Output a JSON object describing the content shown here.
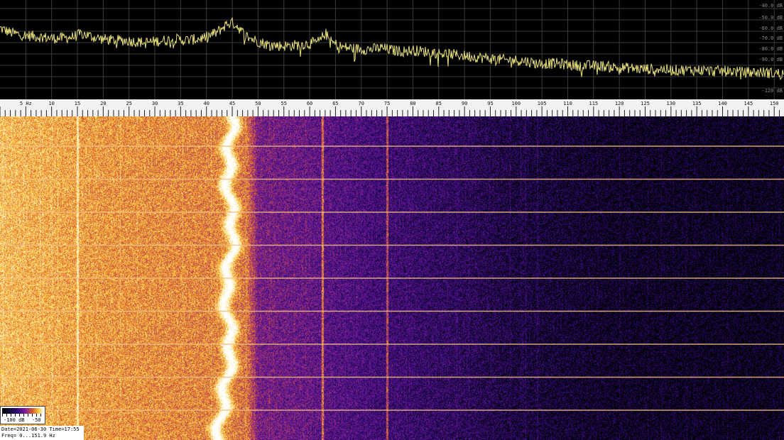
{
  "chart_data": [
    {
      "type": "line",
      "panel": "spectrum",
      "xlim": [
        0,
        151.9
      ],
      "ylim": [
        -120,
        -35
      ],
      "grid": true,
      "y_tick_labels": [
        "-40.0 dB",
        "-50.0 dB",
        "-60.0 dB",
        "-70.0 dB",
        "-80.0 dB",
        "-90.0 dB",
        "-120 dB"
      ],
      "x": [
        0,
        2,
        4,
        6,
        8,
        10,
        12,
        14,
        16,
        18,
        20,
        22,
        24,
        26,
        28,
        30,
        32,
        34,
        36,
        38,
        40,
        42,
        43,
        44,
        45,
        46,
        47,
        48,
        50,
        52,
        54,
        56,
        58,
        60,
        62,
        63,
        64,
        66,
        68,
        70,
        72,
        74,
        76,
        78,
        80,
        82,
        84,
        86,
        88,
        90,
        92,
        94,
        96,
        98,
        100,
        102,
        104,
        106,
        108,
        110,
        112,
        114,
        116,
        118,
        120,
        122,
        124,
        126,
        128,
        130,
        132,
        134,
        136,
        138,
        140,
        142,
        144,
        146,
        148,
        150,
        151.9
      ],
      "values": [
        -58,
        -62,
        -64,
        -65,
        -66,
        -67,
        -67,
        -66,
        -63,
        -66,
        -68,
        -69,
        -69,
        -70,
        -71,
        -70,
        -69,
        -68,
        -69,
        -68,
        -66,
        -62,
        -58,
        -54,
        -53,
        -56,
        -62,
        -66,
        -70,
        -73,
        -74,
        -74,
        -73,
        -72,
        -70,
        -62,
        -70,
        -75,
        -76,
        -77,
        -77,
        -76,
        -78,
        -79,
        -78,
        -79,
        -80,
        -81,
        -82,
        -83,
        -84,
        -85,
        -86,
        -87,
        -87,
        -88,
        -90,
        -90,
        -90,
        -91,
        -92,
        -92,
        -92,
        -93,
        -94,
        -94,
        -95,
        -95,
        -95,
        -96,
        -96,
        -96,
        -96,
        -97,
        -97,
        -97,
        -98,
        -98,
        -98,
        -99,
        -99
      ]
    },
    {
      "type": "heatmap",
      "panel": "waterfall",
      "xlim": [
        0,
        151.9
      ],
      "x_unit": "Hz",
      "x_tick_labels": [
        "5 Hz",
        "10",
        "15",
        "20",
        "25",
        "30",
        "35",
        "40",
        "45",
        "50",
        "55",
        "60",
        "65",
        "70",
        "75",
        "80",
        "85",
        "90",
        "95",
        "100",
        "105",
        "110",
        "115",
        "120",
        "125",
        "130",
        "135",
        "140",
        "145",
        "150"
      ],
      "x_tick_values": [
        5,
        10,
        15,
        20,
        25,
        30,
        35,
        40,
        45,
        50,
        55,
        60,
        65,
        70,
        75,
        80,
        85,
        90,
        95,
        100,
        105,
        110,
        115,
        120,
        125,
        130,
        135,
        140,
        145,
        150
      ],
      "colorscale": [
        "#000000",
        "#2a0a6e",
        "#7a1a9e",
        "#d8602a",
        "#ffd24a",
        "#ffffff"
      ],
      "scale_labels": [
        "-100 dB",
        "-50"
      ],
      "persistent_lines_hz": [
        15,
        45,
        62.5,
        75
      ],
      "drifting_line_hz": [
        45,
        44.5,
        44,
        44.6,
        45.3,
        44.4,
        43.6,
        44.2,
        44.8,
        43.8,
        43,
        42
      ],
      "intensity_profile_hz": [
        0,
        10,
        20,
        30,
        40,
        44,
        48,
        50,
        55,
        60,
        65,
        75,
        90,
        100,
        120,
        151.9
      ],
      "intensity_profile": [
        0.78,
        0.74,
        0.7,
        0.68,
        0.66,
        0.66,
        0.62,
        0.38,
        0.36,
        0.34,
        0.3,
        0.24,
        0.18,
        0.12,
        0.06,
        0.04
      ]
    }
  ],
  "info": {
    "date_label": "Date=2021-06-30",
    "time_label": "Time=17:55",
    "freq_label": "Freq= 0...151.9 Hz"
  }
}
